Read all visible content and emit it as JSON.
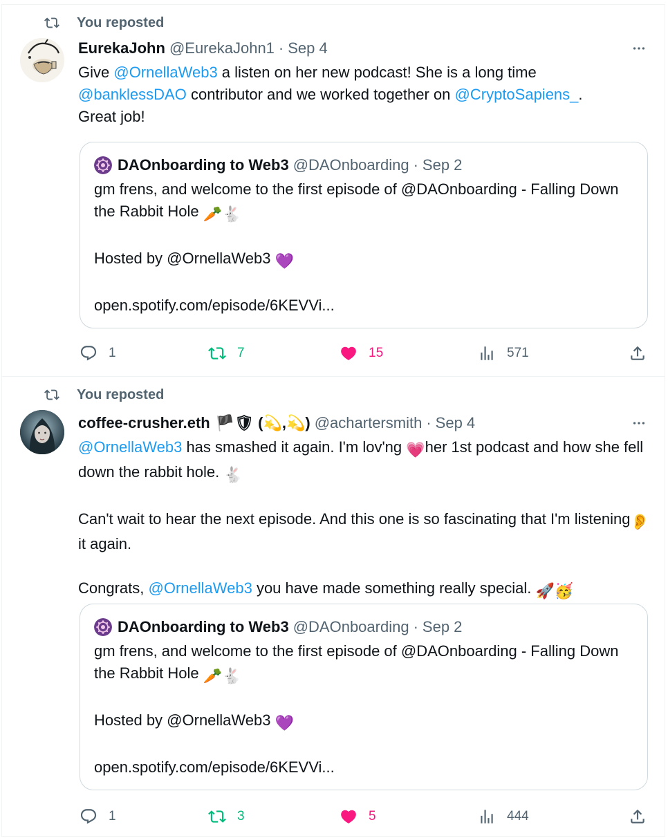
{
  "tweets": [
    {
      "repost_label": "You reposted",
      "name": "EurekaJohn",
      "handle": "@EurekaJohn1",
      "sep": "·",
      "date": "Sep 4",
      "more": "···",
      "body": {
        "l1a": "Give ",
        "l1m": "@OrnellaWeb3",
        "l1b": " a listen on her new podcast!  She is a long time",
        "l2m": "@banklessDAO",
        "l2b": " contributor and we worked together on ",
        "l2m2": "@CryptoSapiens_",
        "l2c": ".",
        "l3": "Great job!"
      },
      "quote": {
        "name": "DAOnboarding to Web3",
        "handle": "@DAOnboarding",
        "sep": "·",
        "date": "Sep 2",
        "p1": "gm frens, and welcome to the first episode of @DAOnboarding - Falling Down the Rabbit Hole",
        "p1_emoji": "🥕🐇",
        "p2": "Hosted by @OrnellaWeb3",
        "p2_emoji": "💜",
        "p3": "open.spotify.com/episode/6KEVVi..."
      },
      "stats": {
        "replies": "1",
        "reposts": "7",
        "likes": "15",
        "views": "571"
      }
    },
    {
      "repost_label": "You reposted",
      "name": "coffee-crusher.eth",
      "name_emoji": "🏴🛡 (💫,💫)",
      "handle": "@achartersmith",
      "sep": "·",
      "date": "Sep 4",
      "more": "···",
      "body": {
        "l1m": "@OrnellaWeb3",
        "l1b": " has smashed it again. I'm lov'ng ",
        "l1e": "💗",
        "l1c": "her 1st podcast and how she fell down the rabbit hole. ",
        "l1e2": "🐇",
        "l2a": "Can't wait to hear the next episode. And this one is so fascinating that I'm listening",
        "l2e": "👂",
        "l2b": " it again.",
        "l3a": "Congrats, ",
        "l3m": "@OrnellaWeb3",
        "l3b": " you have made something really special. ",
        "l3e": "🚀🥳"
      },
      "quote": {
        "name": "DAOnboarding to Web3",
        "handle": "@DAOnboarding",
        "sep": "·",
        "date": "Sep 2",
        "p1": "gm frens, and welcome to the first episode of @DAOnboarding - Falling Down the Rabbit Hole",
        "p1_emoji": "🥕🐇",
        "p2": "Hosted by @OrnellaWeb3",
        "p2_emoji": "💜",
        "p3": "open.spotify.com/episode/6KEVVi..."
      },
      "stats": {
        "replies": "1",
        "reposts": "3",
        "likes": "5",
        "views": "444"
      }
    }
  ],
  "colors": {
    "link": "#1d9bf0",
    "muted": "#536471",
    "repost_green": "#00ba7c",
    "like_pink": "#f91880",
    "border": "#cfd9de",
    "quote_avatar_purple": "#6b3b8c"
  },
  "icons": [
    "repost-icon",
    "more-icon",
    "reply-icon",
    "like-icon",
    "views-icon",
    "share-icon"
  ]
}
